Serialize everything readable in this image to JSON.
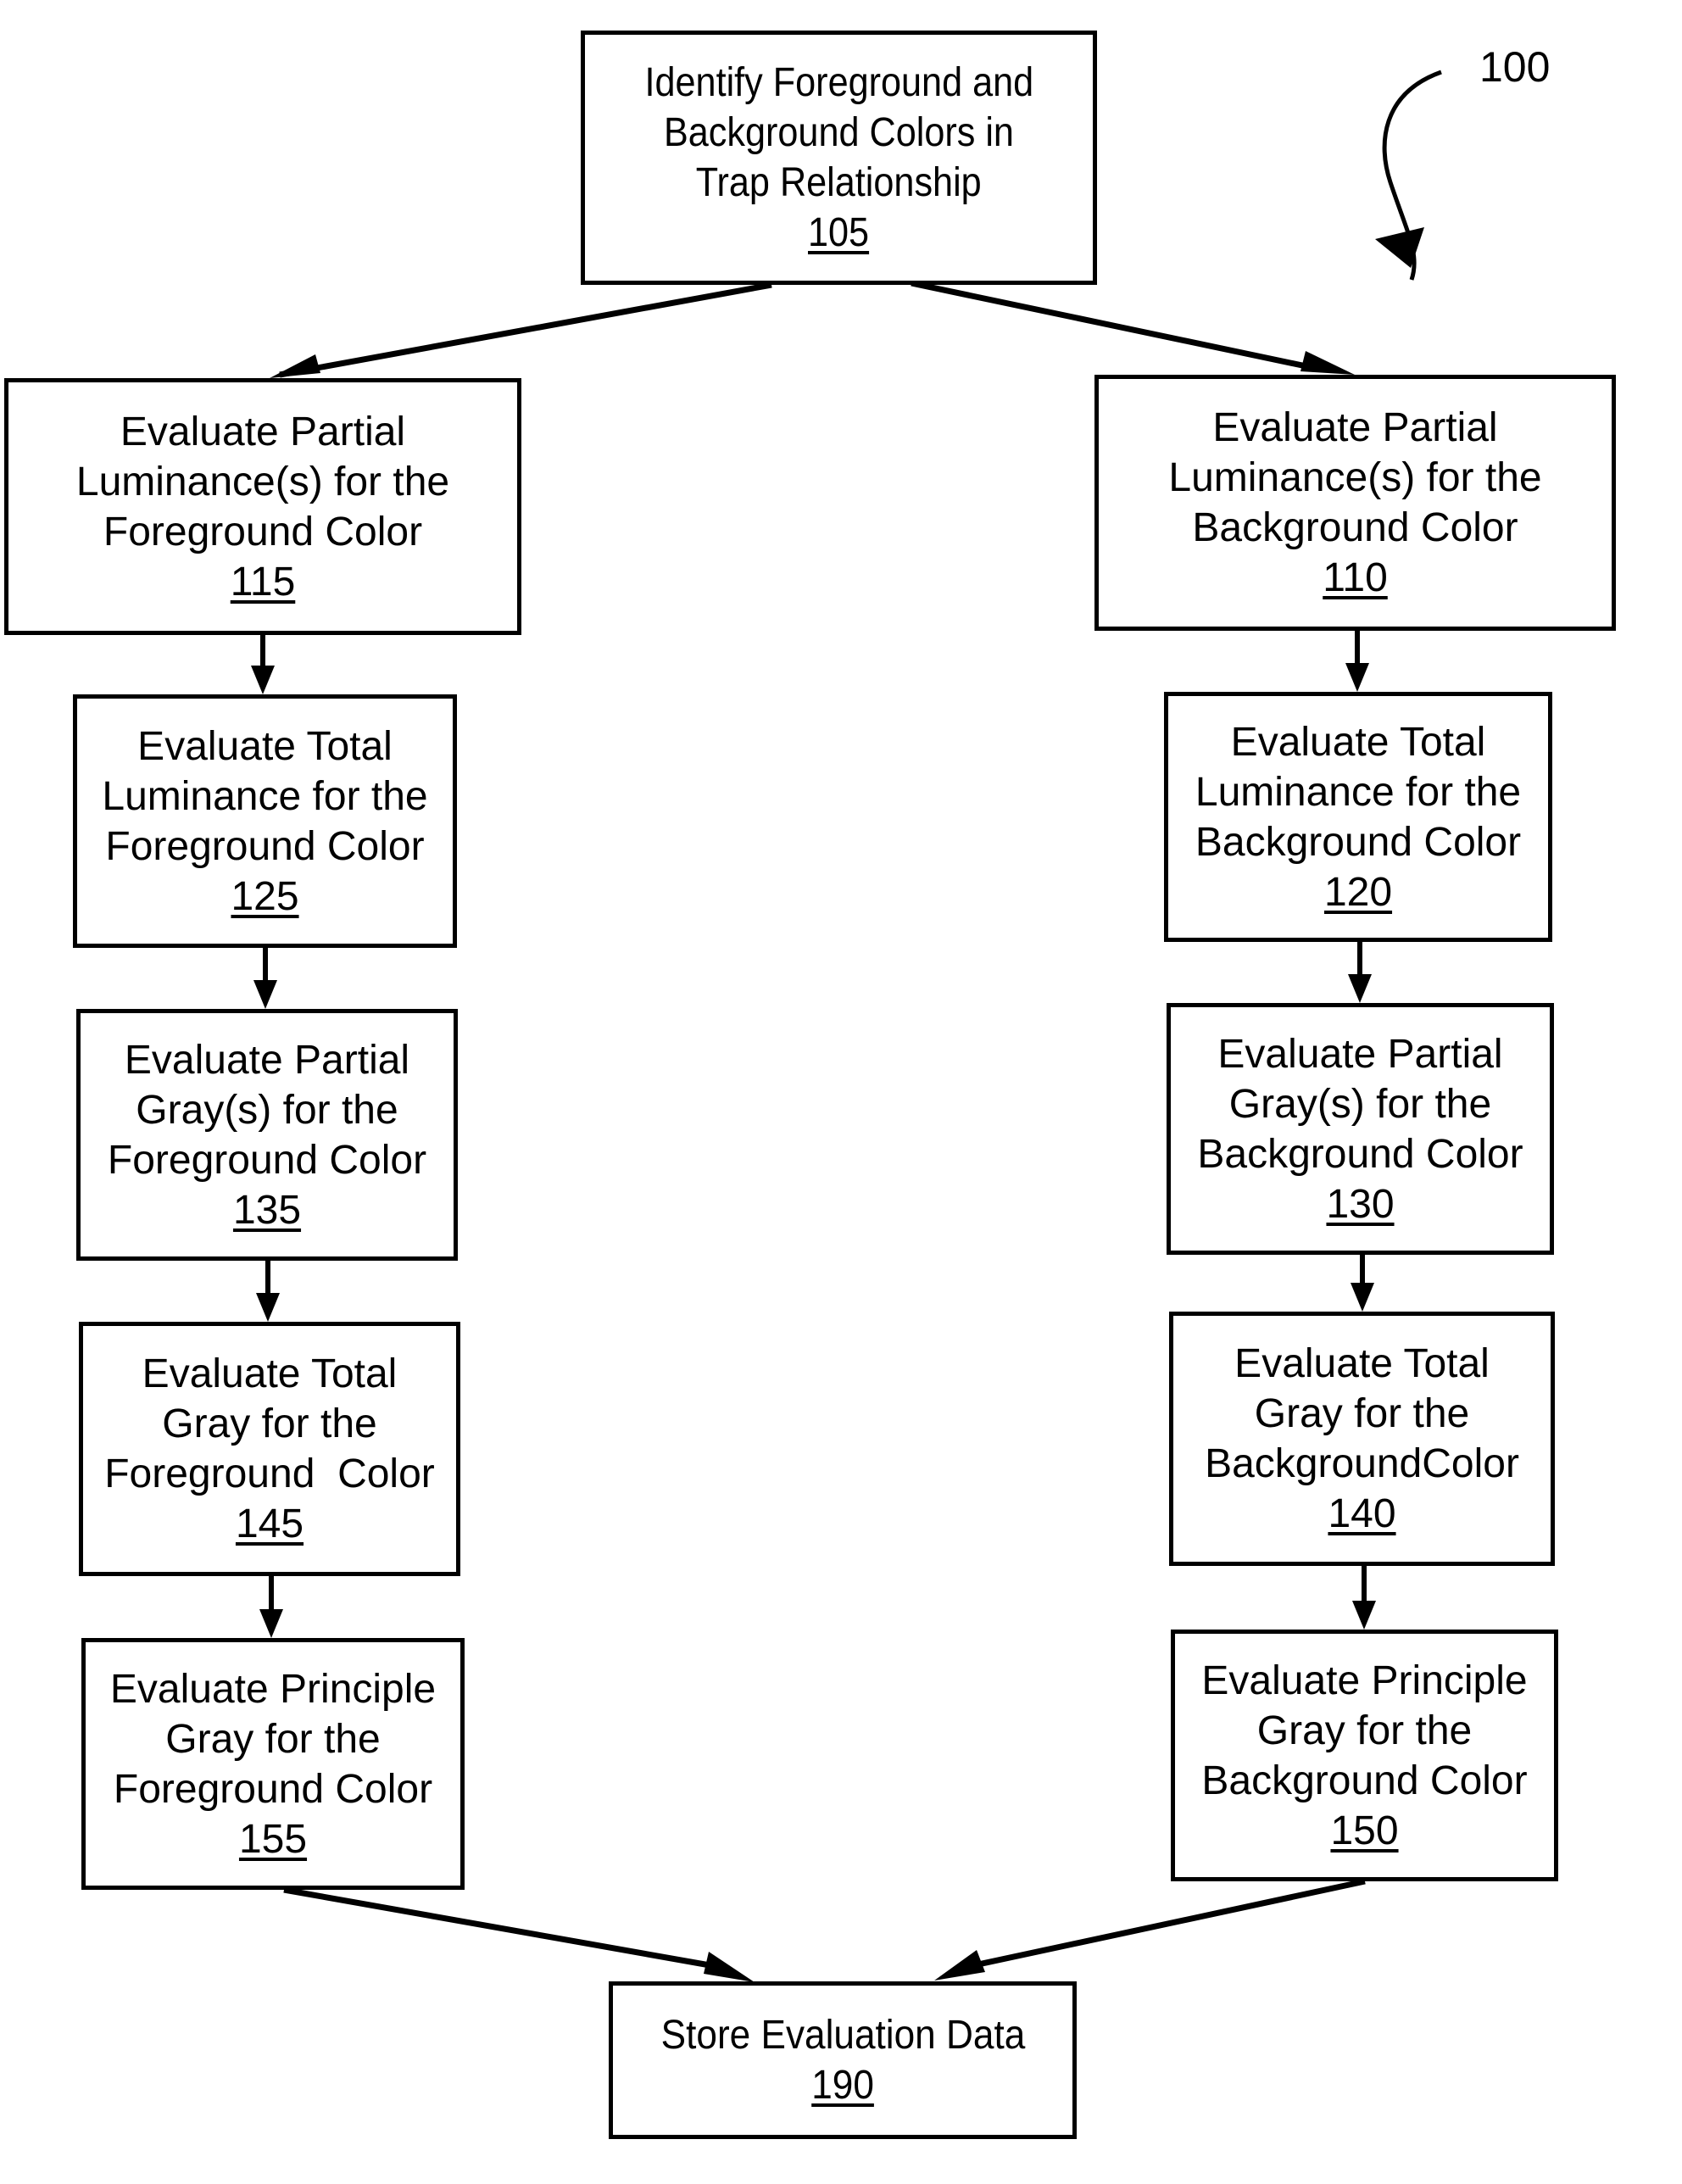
{
  "figure": {
    "label": "100"
  },
  "nodes": {
    "n105": {
      "lines": [
        "Identify Foreground and",
        "Background Colors in",
        "Trap Relationship"
      ],
      "ref": "105"
    },
    "n115": {
      "lines": [
        "Evaluate Partial",
        "Luminance(s) for the",
        "Foreground Color"
      ],
      "ref": "115"
    },
    "n110": {
      "lines": [
        "Evaluate Partial",
        "Luminance(s) for the",
        "Background Color"
      ],
      "ref": "110"
    },
    "n125": {
      "lines": [
        "Evaluate Total",
        "Luminance for the",
        "Foreground Color"
      ],
      "ref": "125"
    },
    "n120": {
      "lines": [
        "Evaluate Total",
        "Luminance for the",
        "Background Color"
      ],
      "ref": "120"
    },
    "n135": {
      "lines": [
        "Evaluate Partial",
        "Gray(s) for the",
        "Foreground Color"
      ],
      "ref": "135"
    },
    "n130": {
      "lines": [
        "Evaluate Partial",
        "Gray(s) for the",
        "Background Color"
      ],
      "ref": "130"
    },
    "n145": {
      "lines": [
        "Evaluate Total",
        "Gray for the",
        "Foreground  Color"
      ],
      "ref": "145"
    },
    "n140": {
      "lines": [
        "Evaluate Total",
        "Gray for the",
        "BackgroundColor"
      ],
      "ref": "140"
    },
    "n155": {
      "lines": [
        "Evaluate Principle",
        "Gray for the",
        "Foreground Color"
      ],
      "ref": "155"
    },
    "n150": {
      "lines": [
        "Evaluate Principle",
        "Gray for the",
        "Background Color"
      ],
      "ref": "150"
    },
    "n190": {
      "lines": [
        "Store Evaluation Data"
      ],
      "ref": "190"
    }
  },
  "edges": [
    {
      "from": "105",
      "to": "115"
    },
    {
      "from": "105",
      "to": "110"
    },
    {
      "from": "115",
      "to": "125"
    },
    {
      "from": "125",
      "to": "135"
    },
    {
      "from": "135",
      "to": "145"
    },
    {
      "from": "145",
      "to": "155"
    },
    {
      "from": "110",
      "to": "120"
    },
    {
      "from": "120",
      "to": "130"
    },
    {
      "from": "130",
      "to": "140"
    },
    {
      "from": "140",
      "to": "150"
    },
    {
      "from": "155",
      "to": "190"
    },
    {
      "from": "150",
      "to": "190"
    }
  ]
}
